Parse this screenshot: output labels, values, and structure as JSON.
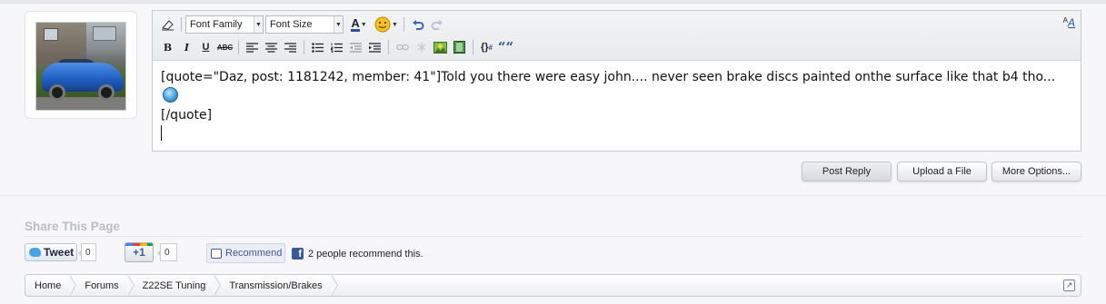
{
  "editor": {
    "toolbar_row1": {
      "font_family": "Font Family",
      "font_size": "Font Size",
      "font_color_glyph": "A",
      "text_size_glyph_small": "A",
      "text_size_glyph_large": "A"
    },
    "toolbar_row2": {
      "bold": "B",
      "italic": "I",
      "underline": "U",
      "strikethrough": "ABC",
      "code": "{}",
      "code_sub": "#",
      "quote": "““"
    },
    "content": {
      "line1": "[quote=\"Daz, post: 1181242, member: 41\"]Told you there were easy john.... never seen brake discs painted onthe surface like that b4 tho...",
      "line2": "[/quote]"
    }
  },
  "buttons": {
    "post_reply": "Post Reply",
    "upload_file": "Upload a File",
    "more_options": "More Options..."
  },
  "share": {
    "title": "Share This Page",
    "tweet_label": "Tweet",
    "tweet_count": "0",
    "plusone_label": "+1",
    "plusone_count": "0",
    "recommend_label": "Recommend",
    "recommend_text": "2 people recommend this."
  },
  "breadcrumb": {
    "items": [
      "Home",
      "Forums",
      "Z22SE Tuning",
      "Transmission/Brakes"
    ]
  },
  "colors": {
    "facebook_blue": "#3b5998",
    "twitter_blue": "#47a4e8",
    "editor_border": "#c6cad1"
  }
}
